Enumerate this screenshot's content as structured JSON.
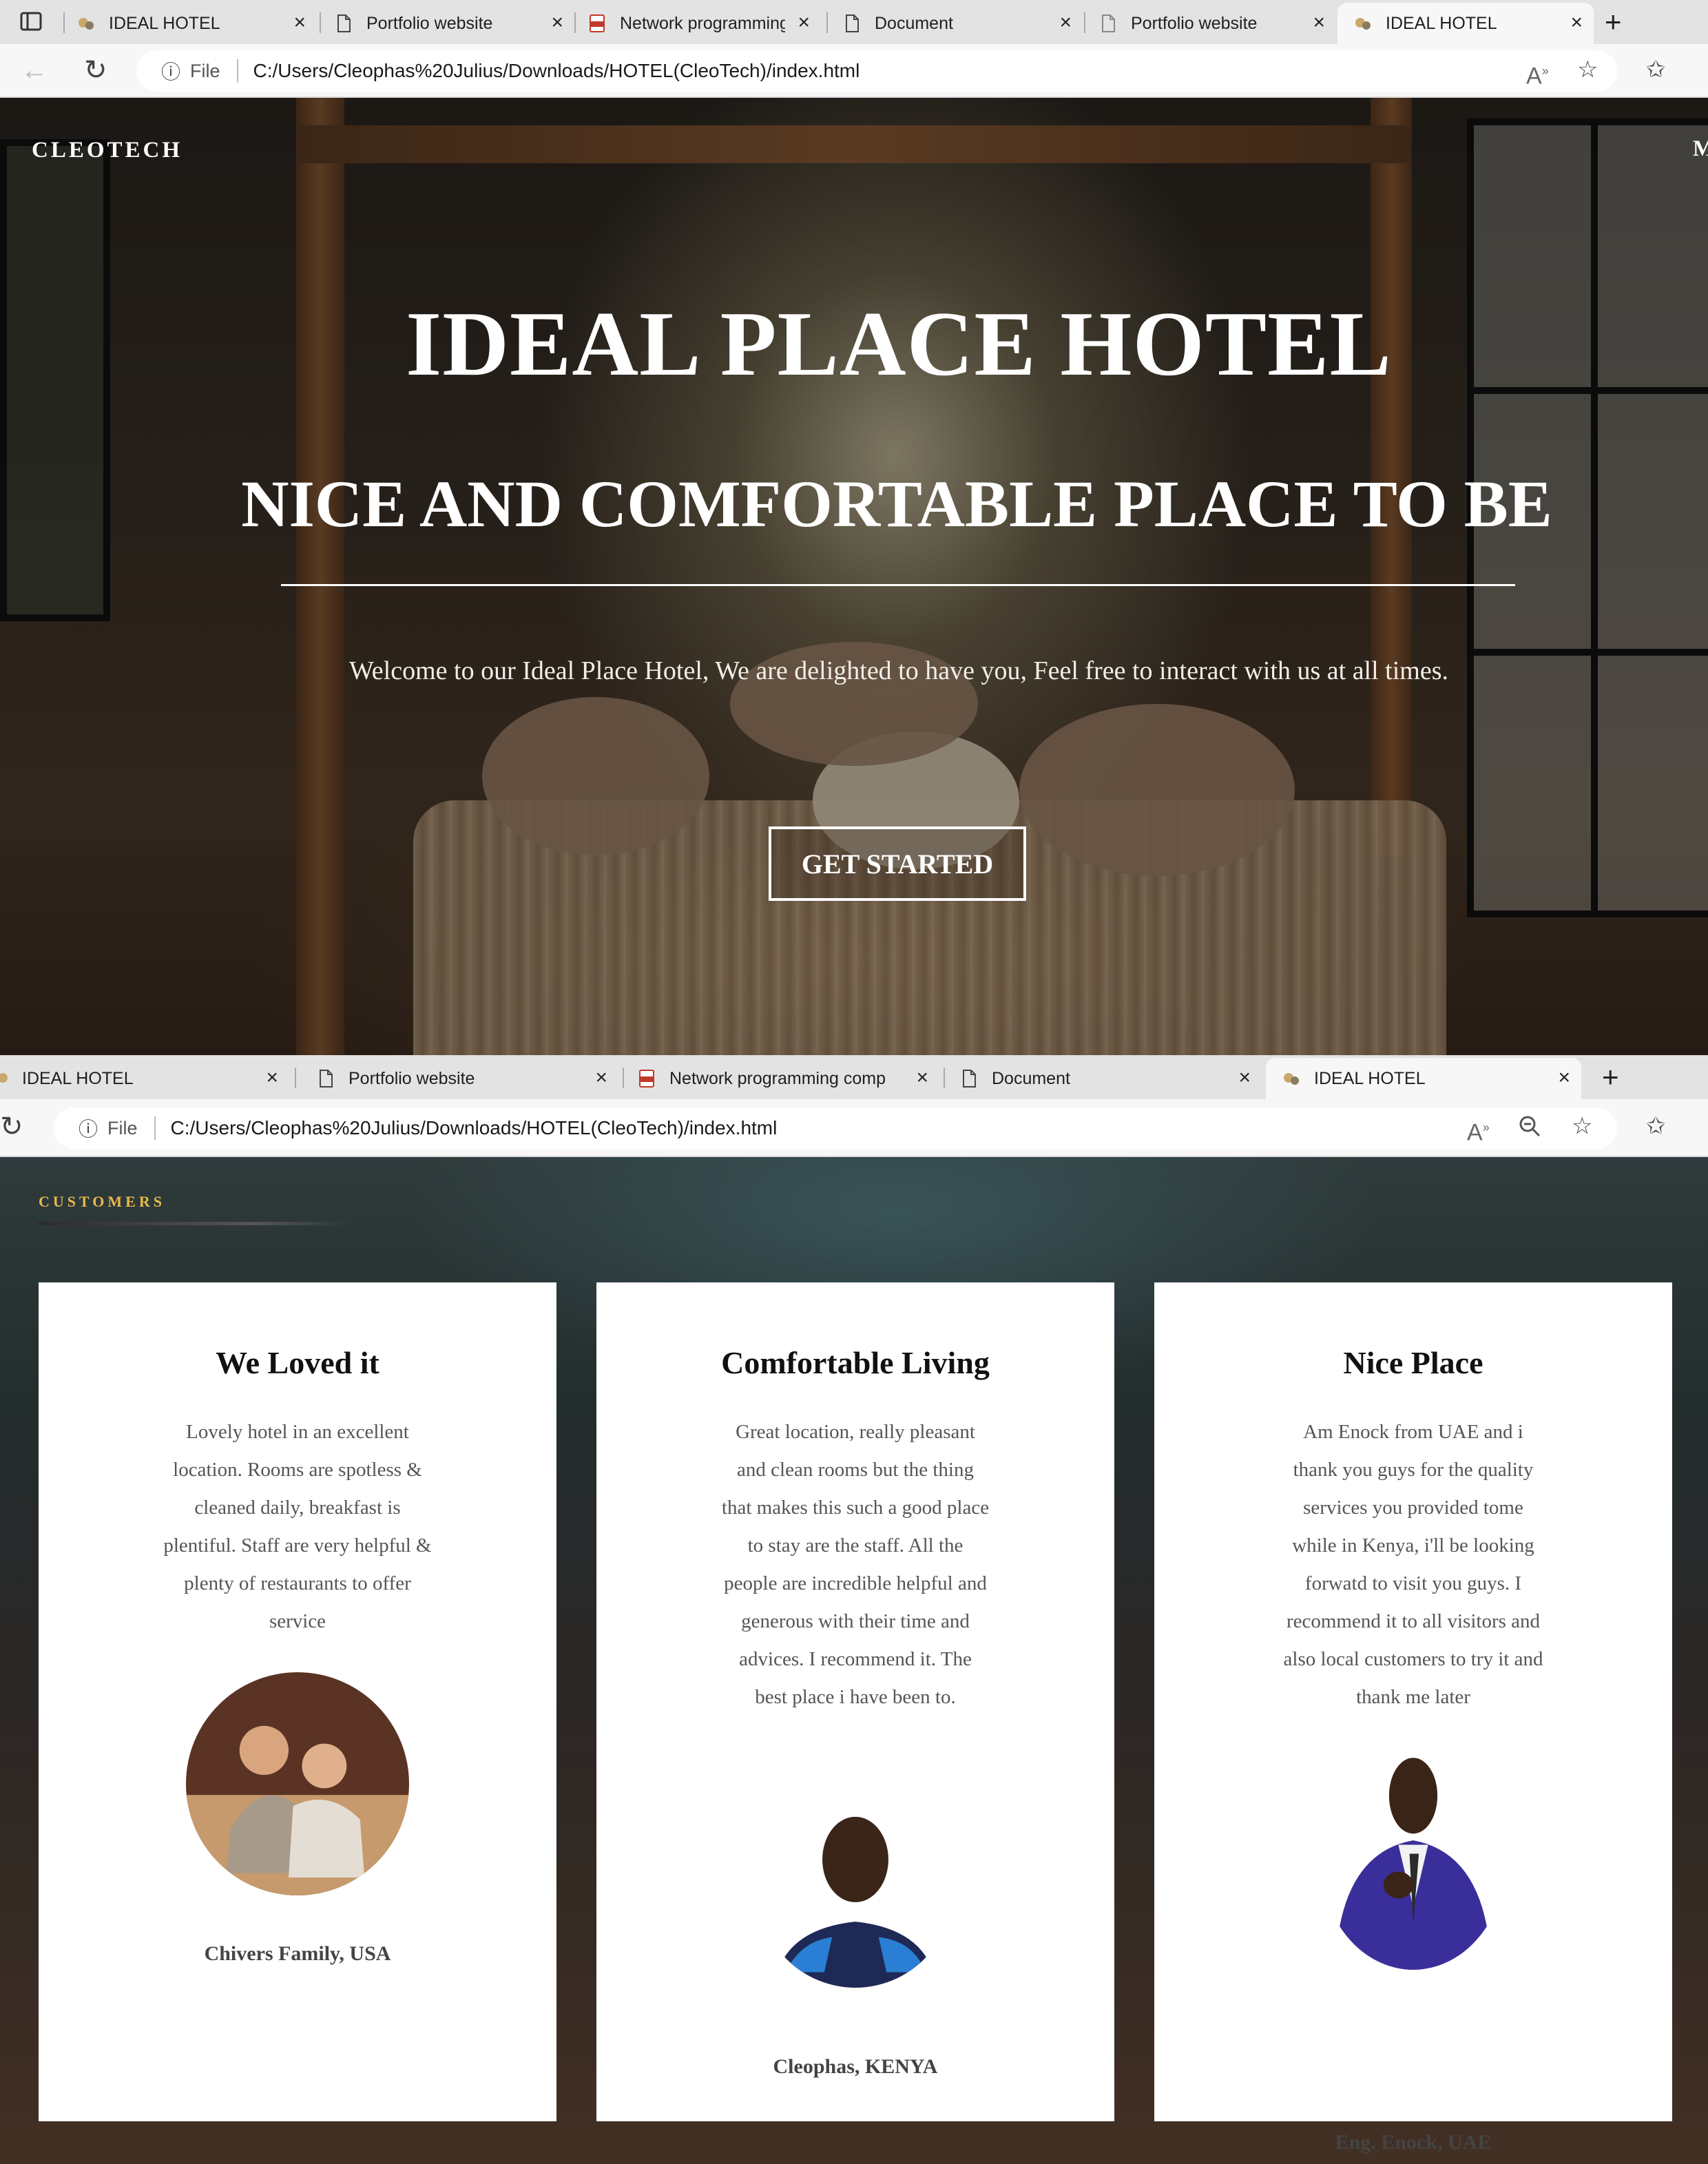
{
  "browser_top": {
    "tabs": [
      {
        "label": "IDEAL HOTEL",
        "icon": "hotel-favicon-icon"
      },
      {
        "label": "Portfolio website",
        "icon": "page-icon"
      },
      {
        "label": "Network programming",
        "icon": "pdf-icon"
      },
      {
        "label": "Document",
        "icon": "page-icon"
      },
      {
        "label": "Portfolio website",
        "icon": "page-icon"
      },
      {
        "label": "IDEAL HOTEL",
        "icon": "hotel-favicon-icon",
        "active": true
      }
    ],
    "address": {
      "info_label": "File",
      "url": "C:/Users/Cleophas%20Julius/Downloads/HOTEL(CleoTech)/index.html"
    }
  },
  "browser_second": {
    "tabs": [
      {
        "label": "IDEAL HOTEL",
        "icon": "hotel-favicon-icon"
      },
      {
        "label": "Portfolio website",
        "icon": "page-icon"
      },
      {
        "label": "Network programming comp",
        "icon": "pdf-icon"
      },
      {
        "label": "Document",
        "icon": "page-icon"
      },
      {
        "label": "IDEAL HOTEL",
        "icon": "hotel-favicon-icon",
        "active": true
      }
    ],
    "address": {
      "info_label": "File",
      "url": "C:/Users/Cleophas%20Julius/Downloads/HOTEL(CleoTech)/index.html"
    }
  },
  "hero": {
    "brand": "CLEOTECH",
    "menu_edge": "M",
    "title": "IDEAL PLACE HOTEL",
    "subtitle": "NICE AND COMFORTABLE PLACE TO BE",
    "welcome": "Welcome to our Ideal Place Hotel, We are delighted to have you, Feel free to interact with us at all times.",
    "cta_label": "GET STARTED"
  },
  "customers": {
    "section_label": "CUSTOMERS",
    "accent_color": "#e8b84a",
    "cards": [
      {
        "title": "We Loved it",
        "text": "Lovely hotel in an excellent location. Rooms are spotless & cleaned daily, breakfast is plentiful. Staff are very helpful & plenty of restaurants to offer service",
        "name": "Chivers Family, USA"
      },
      {
        "title": "Comfortable Living",
        "text": "Great location, really pleasant and clean rooms but the thing that makes this such a good place to stay are the staff. All the people are incredible helpful and generous with their time and advices. I recommend it. The best place i have been to.",
        "name": "Cleophas, KENYA"
      },
      {
        "title": "Nice Place",
        "text": "Am Enock from UAE and i thank you guys for the quality services you provided tome while in Kenya, i'll be looking forwatd to visit you guys. I recommend it to all visitors and also local customers to try it and thank me later",
        "name": "Eng. Enock, UAE"
      }
    ]
  }
}
